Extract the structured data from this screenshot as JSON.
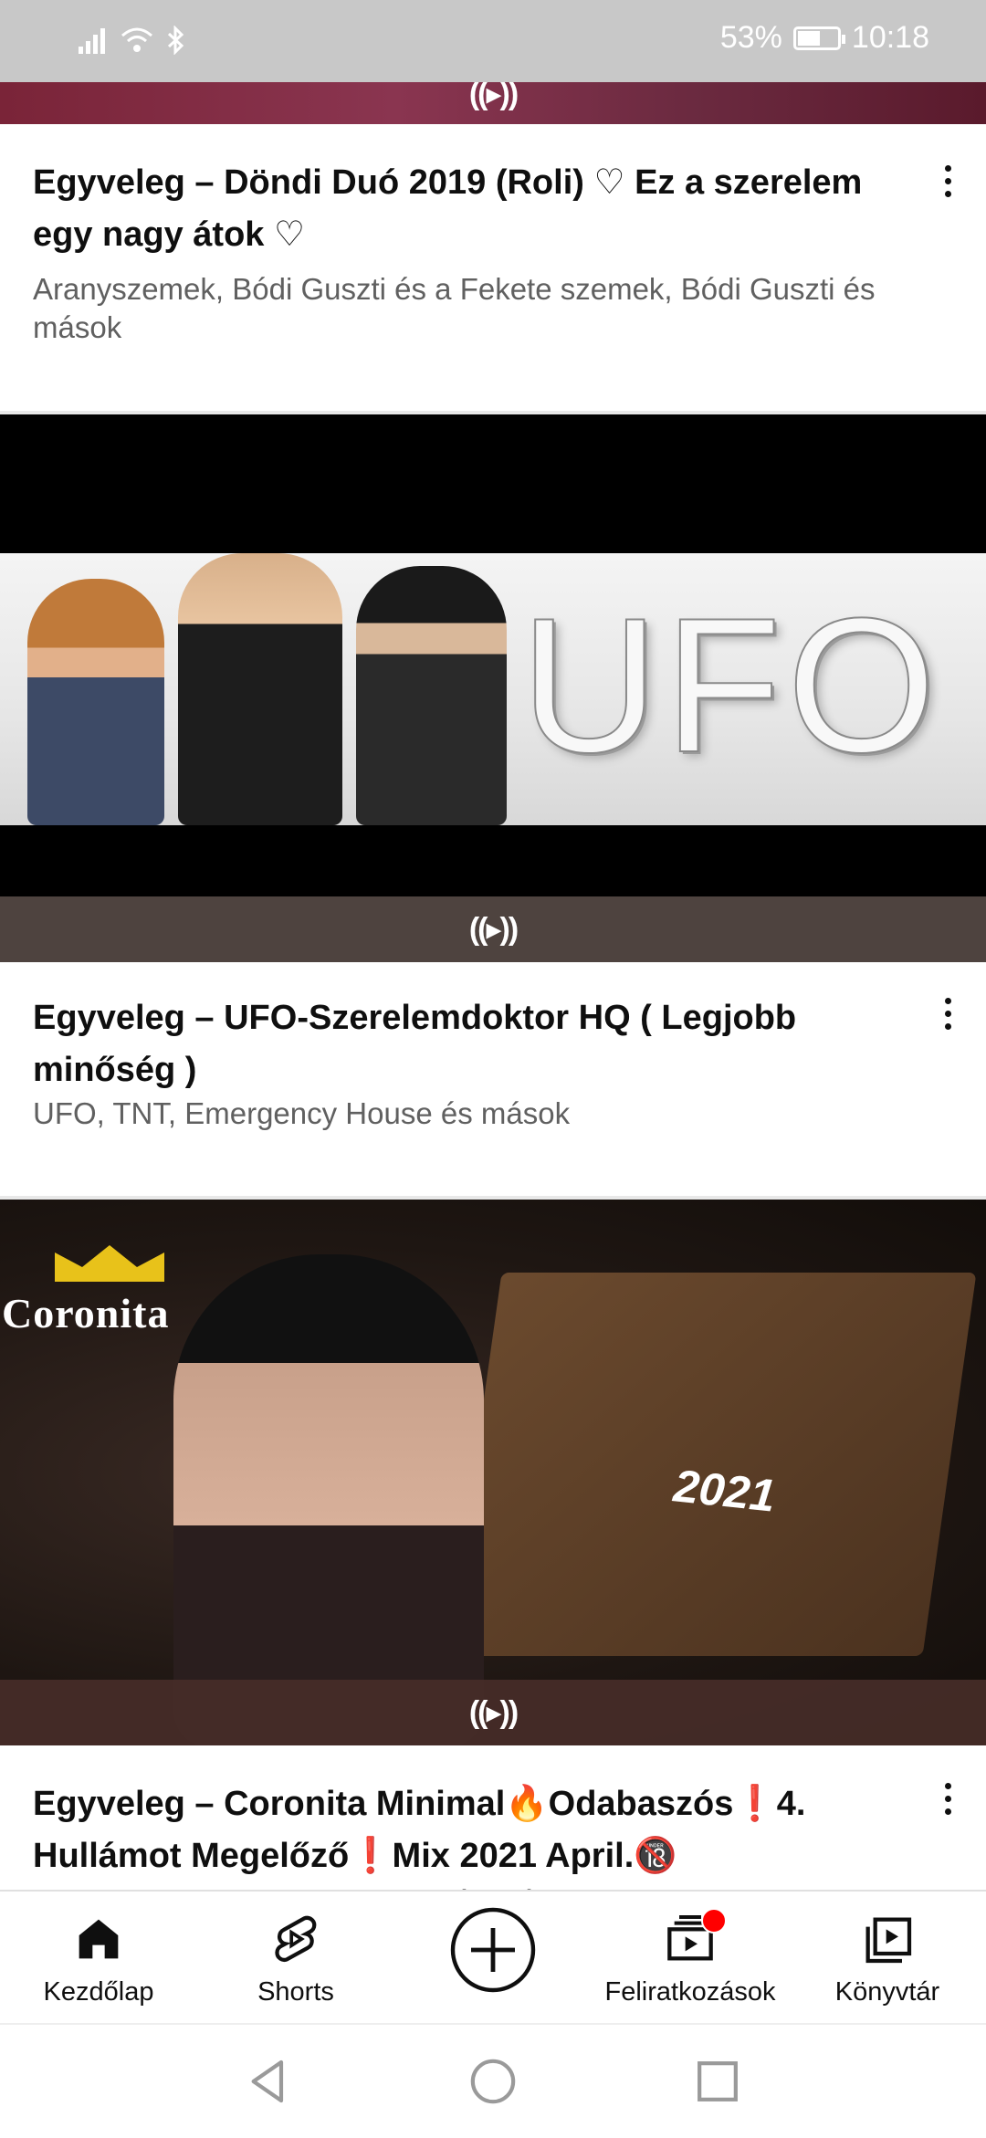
{
  "status_bar": {
    "battery": "53%",
    "time": "10:18"
  },
  "videos": [
    {
      "title": "Egyveleg – Döndi Duó 2019 (Roli) ♡  Ez a szerelem egy nagy átok ♡",
      "meta": "Aranyszemek, Bódi Guszti és a Fekete szemek, Bódi Guszti és mások",
      "live_icon": "((▸))"
    },
    {
      "title": "Egyveleg – UFO-Szerelemdoktor HQ ( Legjobb minőség )",
      "meta": "UFO, TNT, Emergency House és mások",
      "live_icon": "((▸))",
      "thumb_text": "UFO"
    },
    {
      "title": "Egyveleg – Coronita Minimal🔥Odabaszós❗4. Hullámot Megelőző❗Mix 2021 April.🔞",
      "meta": "DJ Zoker, Bagdi, Dancs... Cibu és mások",
      "live_icon": "((▸))",
      "thumb_text": "Coronita",
      "thumb_text_2": "2021"
    }
  ],
  "bottom_nav": {
    "home": "Kezdőlap",
    "shorts": "Shorts",
    "subscriptions": "Feliratkozások",
    "library": "Könyvtár"
  },
  "colors": {
    "accent": "#ff0000",
    "status_bar_bg": "#c8c8c8",
    "text_primary": "#0f0f0f",
    "text_secondary": "#606060"
  }
}
